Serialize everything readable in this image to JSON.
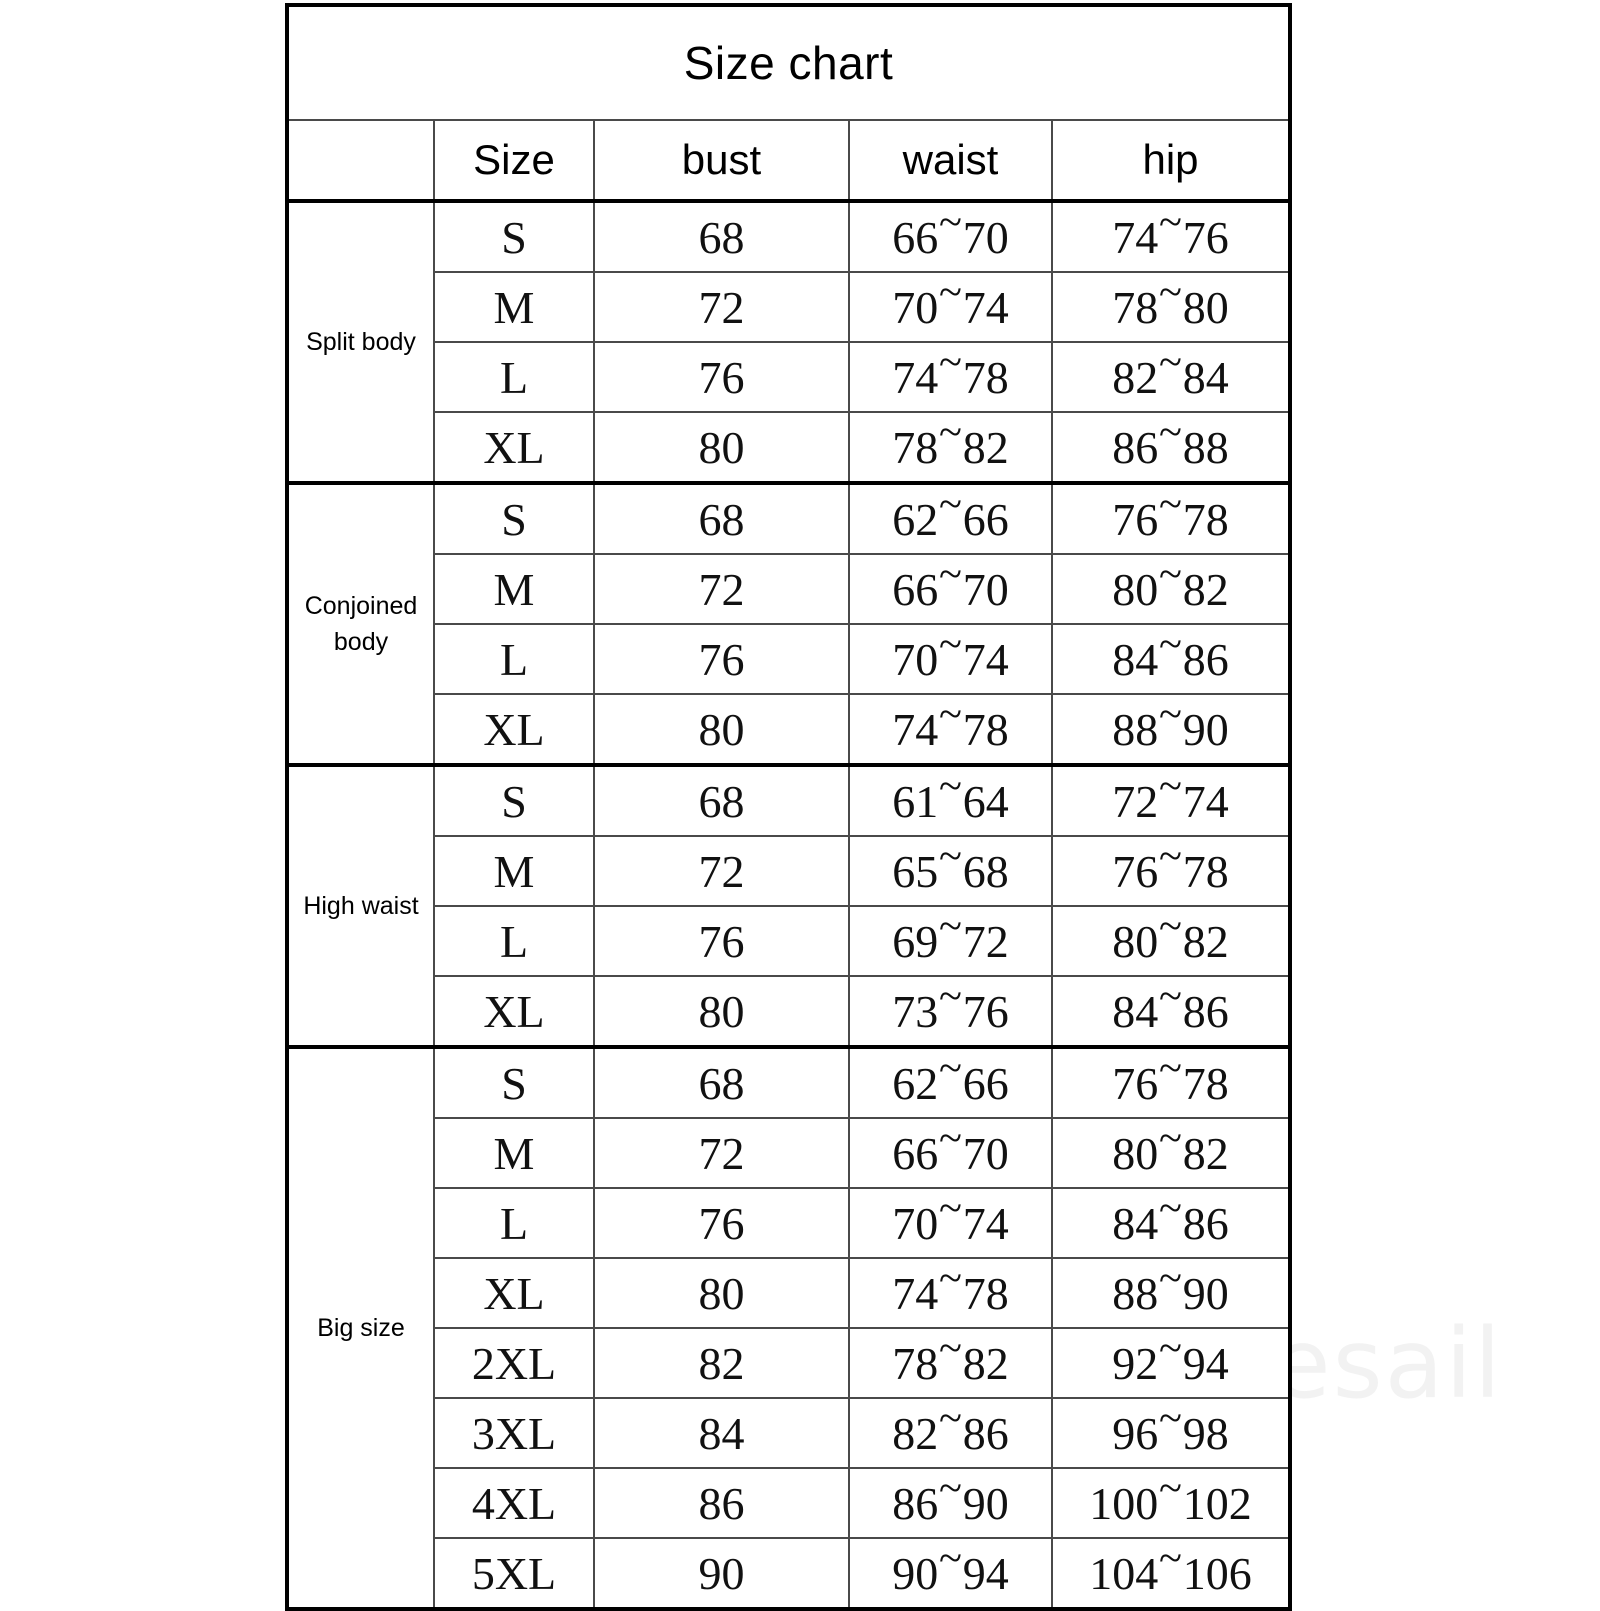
{
  "title": "Size chart",
  "watermark": "aisesail",
  "colors": {
    "header_fill": "#FFFF00",
    "border": "#000000",
    "text": "#000000",
    "watermark": "#F2F2F2"
  },
  "columns": {
    "category": "",
    "size": "Size",
    "bust": "bust",
    "waist": "waist",
    "hip": "hip"
  },
  "groups": [
    {
      "name": "Split body",
      "rows": [
        {
          "size": "S",
          "bust": "68",
          "waist_lo": "66",
          "waist_hi": "70",
          "hip_lo": "74",
          "hip_hi": "76"
        },
        {
          "size": "M",
          "bust": "72",
          "waist_lo": "70",
          "waist_hi": "74",
          "hip_lo": "78",
          "hip_hi": "80"
        },
        {
          "size": "L",
          "bust": "76",
          "waist_lo": "74",
          "waist_hi": "78",
          "hip_lo": "82",
          "hip_hi": "84"
        },
        {
          "size": "XL",
          "bust": "80",
          "waist_lo": "78",
          "waist_hi": "82",
          "hip_lo": "86",
          "hip_hi": "88"
        }
      ]
    },
    {
      "name": "Conjoined body",
      "rows": [
        {
          "size": "S",
          "bust": "68",
          "waist_lo": "62",
          "waist_hi": "66",
          "hip_lo": "76",
          "hip_hi": "78"
        },
        {
          "size": "M",
          "bust": "72",
          "waist_lo": "66",
          "waist_hi": "70",
          "hip_lo": "80",
          "hip_hi": "82"
        },
        {
          "size": "L",
          "bust": "76",
          "waist_lo": "70",
          "waist_hi": "74",
          "hip_lo": "84",
          "hip_hi": "86"
        },
        {
          "size": "XL",
          "bust": "80",
          "waist_lo": "74",
          "waist_hi": "78",
          "hip_lo": "88",
          "hip_hi": "90"
        }
      ]
    },
    {
      "name": "High waist",
      "rows": [
        {
          "size": "S",
          "bust": "68",
          "waist_lo": "61",
          "waist_hi": "64",
          "hip_lo": "72",
          "hip_hi": "74"
        },
        {
          "size": "M",
          "bust": "72",
          "waist_lo": "65",
          "waist_hi": "68",
          "hip_lo": "76",
          "hip_hi": "78"
        },
        {
          "size": "L",
          "bust": "76",
          "waist_lo": "69",
          "waist_hi": "72",
          "hip_lo": "80",
          "hip_hi": "82"
        },
        {
          "size": "XL",
          "bust": "80",
          "waist_lo": "73",
          "waist_hi": "76",
          "hip_lo": "84",
          "hip_hi": "86"
        }
      ]
    },
    {
      "name": "Big size",
      "rows": [
        {
          "size": "S",
          "bust": "68",
          "waist_lo": "62",
          "waist_hi": "66",
          "hip_lo": "76",
          "hip_hi": "78"
        },
        {
          "size": "M",
          "bust": "72",
          "waist_lo": "66",
          "waist_hi": "70",
          "hip_lo": "80",
          "hip_hi": "82"
        },
        {
          "size": "L",
          "bust": "76",
          "waist_lo": "70",
          "waist_hi": "74",
          "hip_lo": "84",
          "hip_hi": "86"
        },
        {
          "size": "XL",
          "bust": "80",
          "waist_lo": "74",
          "waist_hi": "78",
          "hip_lo": "88",
          "hip_hi": "90"
        },
        {
          "size": "2XL",
          "bust": "82",
          "waist_lo": "78",
          "waist_hi": "82",
          "hip_lo": "92",
          "hip_hi": "94"
        },
        {
          "size": "3XL",
          "bust": "84",
          "waist_lo": "82",
          "waist_hi": "86",
          "hip_lo": "96",
          "hip_hi": "98"
        },
        {
          "size": "4XL",
          "bust": "86",
          "waist_lo": "86",
          "waist_hi": "90",
          "hip_lo": "100",
          "hip_hi": "102"
        },
        {
          "size": "5XL",
          "bust": "90",
          "waist_lo": "90",
          "waist_hi": "94",
          "hip_lo": "104",
          "hip_hi": "106"
        }
      ]
    }
  ],
  "range_separator": "~"
}
